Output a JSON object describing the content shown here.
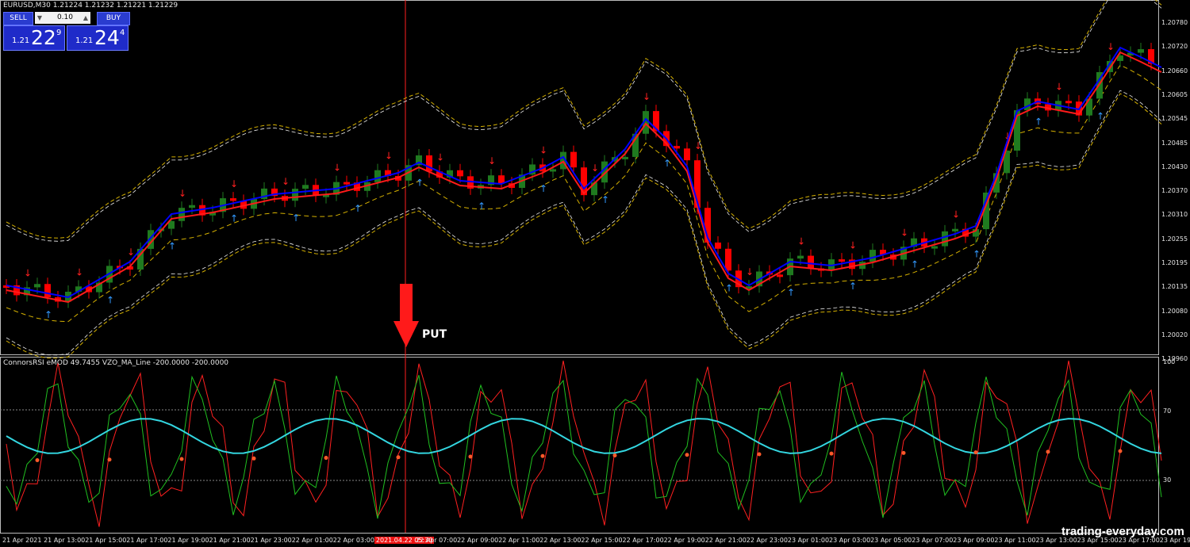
{
  "main_chart": {
    "title": "EURUSD,M30  1.21224 1.21232 1.21221 1.21229",
    "price_labels": [
      "1.20780",
      "1.20720",
      "1.20660",
      "1.20605",
      "1.20545",
      "1.20485",
      "1.20430",
      "1.20370",
      "1.20310",
      "1.20255",
      "1.20195",
      "1.20135",
      "1.20080",
      "1.20020",
      "1.19960"
    ],
    "annotation": "PUT"
  },
  "trade_panel": {
    "sell_label": "SELL",
    "buy_label": "BUY",
    "lot_value": "0.10",
    "sell_price": {
      "prefix": "1.21",
      "big": "22",
      "sup": "9"
    },
    "buy_price": {
      "prefix": "1.21",
      "big": "24",
      "sup": "4"
    }
  },
  "oscillator": {
    "title": "ConnorsRSI eMOD 49.7455  VZO_MA_Line -200.0000 -200.0000",
    "levels": [
      "100",
      "70",
      "30"
    ]
  },
  "time_axis": {
    "labels": [
      "21 Apr 2021",
      "21 Apr 13:00",
      "21 Apr 15:00",
      "21 Apr 17:00",
      "21 Apr 19:00",
      "21 Apr 21:00",
      "21 Apr 23:00",
      "22 Apr 01:00",
      "22 Apr 03:00",
      "2021.04.22 05:30",
      "22 Apr 07:00",
      "22 Apr 09:00",
      "22 Apr 11:00",
      "22 Apr 13:00",
      "22 Apr 15:00",
      "22 Apr 17:00",
      "22 Apr 19:00",
      "22 Apr 21:00",
      "22 Apr 23:00",
      "23 Apr 01:00",
      "23 Apr 03:00",
      "23 Apr 05:00",
      "23 Apr 07:00",
      "23 Apr 09:00",
      "23 Apr 11:00",
      "23 Apr 13:00",
      "23 Apr 15:00",
      "23 Apr 17:00",
      "23 Apr 19:00"
    ],
    "highlighted_index": 9
  },
  "watermark": "trading-everyday.com",
  "colors": {
    "bull": "#1f7a1f",
    "bear": "#ff0000",
    "ma_fast": "#0000ff",
    "ma_slow": "#ff1a1a",
    "band": "#d4b000",
    "crsi": "#ff2020",
    "vzo": "#20c020",
    "signal": "#33d6e0",
    "arrow_up": "#3399ff",
    "arrow_down": "#ff2020"
  }
}
